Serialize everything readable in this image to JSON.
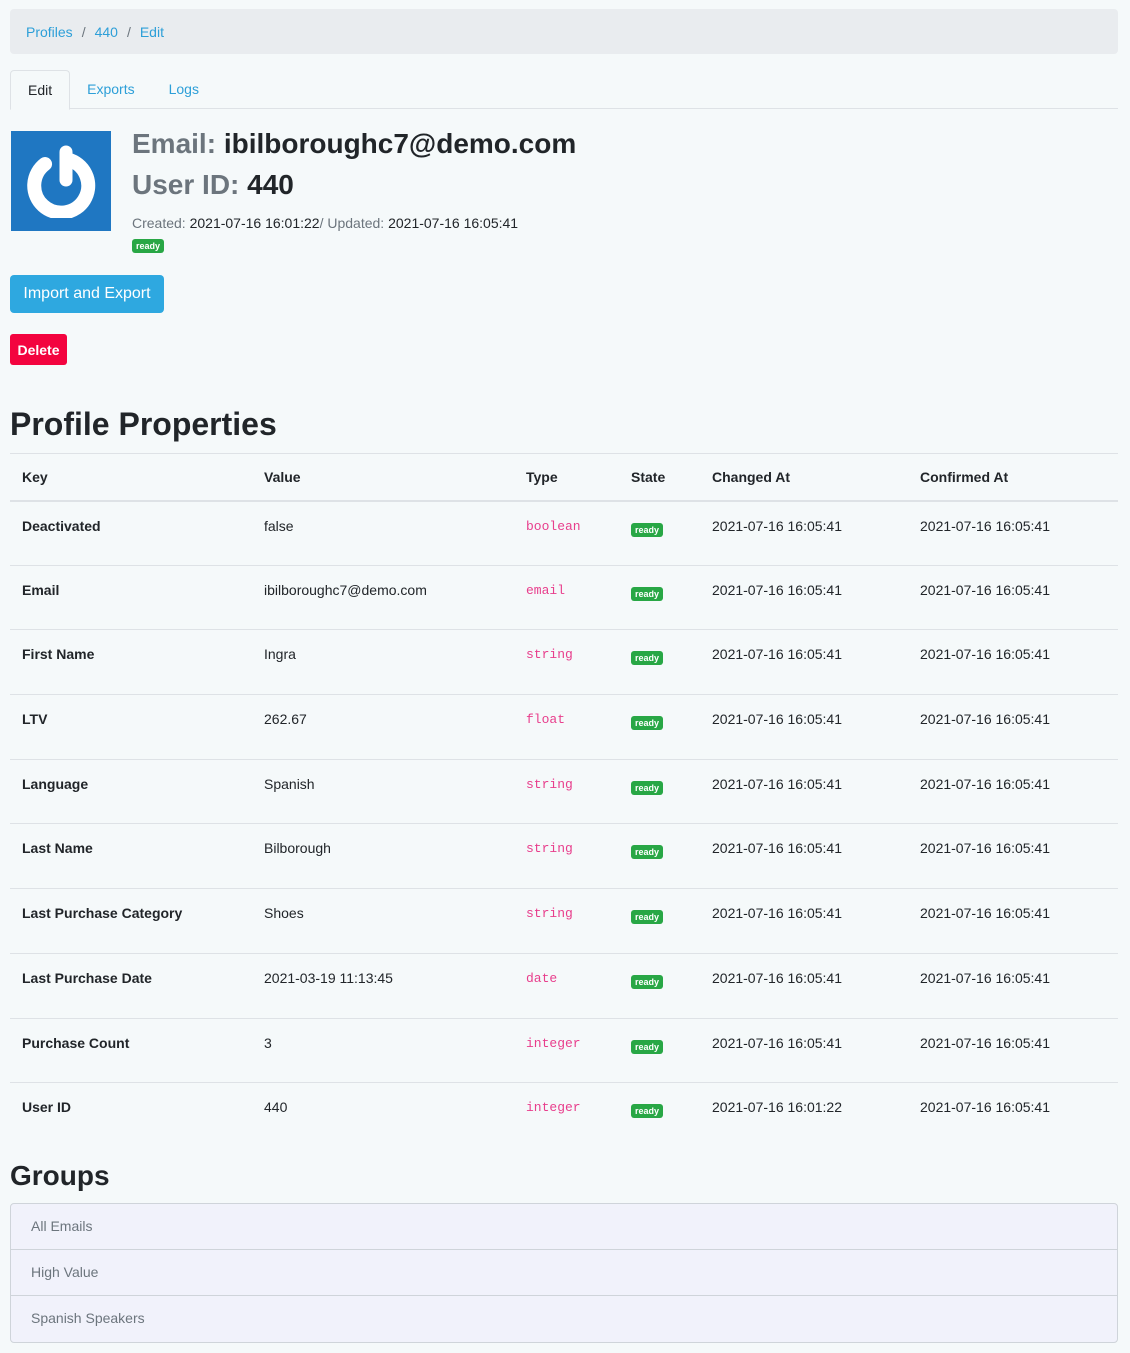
{
  "breadcrumb": {
    "items": [
      "Profiles",
      "440",
      "Edit"
    ],
    "separator": "/"
  },
  "tabs": [
    "Edit",
    "Exports",
    "Logs"
  ],
  "header": {
    "email_label": "Email:",
    "email": "ibilboroughc7@demo.com",
    "userid_label": "User ID:",
    "userid": "440",
    "created_label": "Created:",
    "created": "2021-07-16 16:01:22",
    "updated_label": "/ Updated:",
    "updated": "2021-07-16 16:05:41",
    "status": "ready",
    "avatar_icon": "power-icon"
  },
  "buttons": {
    "import_export": "Import and Export",
    "delete": "Delete"
  },
  "properties": {
    "title": "Profile Properties",
    "columns": [
      "Key",
      "Value",
      "Type",
      "State",
      "Changed At",
      "Confirmed At"
    ],
    "rows": [
      {
        "key": "Deactivated",
        "value": "false",
        "type": "boolean",
        "state": "ready",
        "changed": "2021-07-16 16:05:41",
        "confirmed": "2021-07-16 16:05:41"
      },
      {
        "key": "Email",
        "value": "ibilboroughc7@demo.com",
        "type": "email",
        "state": "ready",
        "changed": "2021-07-16 16:05:41",
        "confirmed": "2021-07-16 16:05:41"
      },
      {
        "key": "First Name",
        "value": "Ingra",
        "type": "string",
        "state": "ready",
        "changed": "2021-07-16 16:05:41",
        "confirmed": "2021-07-16 16:05:41"
      },
      {
        "key": "LTV",
        "value": "262.67",
        "type": "float",
        "state": "ready",
        "changed": "2021-07-16 16:05:41",
        "confirmed": "2021-07-16 16:05:41"
      },
      {
        "key": "Language",
        "value": "Spanish",
        "type": "string",
        "state": "ready",
        "changed": "2021-07-16 16:05:41",
        "confirmed": "2021-07-16 16:05:41"
      },
      {
        "key": "Last Name",
        "value": "Bilborough",
        "type": "string",
        "state": "ready",
        "changed": "2021-07-16 16:05:41",
        "confirmed": "2021-07-16 16:05:41"
      },
      {
        "key": "Last Purchase Category",
        "value": "Shoes",
        "type": "string",
        "state": "ready",
        "changed": "2021-07-16 16:05:41",
        "confirmed": "2021-07-16 16:05:41"
      },
      {
        "key": "Last Purchase Date",
        "value": "2021-03-19 11:13:45",
        "type": "date",
        "state": "ready",
        "changed": "2021-07-16 16:05:41",
        "confirmed": "2021-07-16 16:05:41"
      },
      {
        "key": "Purchase Count",
        "value": "3",
        "type": "integer",
        "state": "ready",
        "changed": "2021-07-16 16:05:41",
        "confirmed": "2021-07-16 16:05:41"
      },
      {
        "key": "User ID",
        "value": "440",
        "type": "integer",
        "state": "ready",
        "changed": "2021-07-16 16:01:22",
        "confirmed": "2021-07-16 16:05:41"
      }
    ]
  },
  "groups": {
    "title": "Groups",
    "items": [
      "All Emails",
      "High Value",
      "Spanish Speakers"
    ]
  },
  "colors": {
    "link": "#2d9fd8",
    "primary": "#2ea8e0",
    "danger": "#f3043f",
    "success": "#28a745",
    "type_text": "#e83e8c",
    "avatar_bg": "#1f77c2"
  }
}
